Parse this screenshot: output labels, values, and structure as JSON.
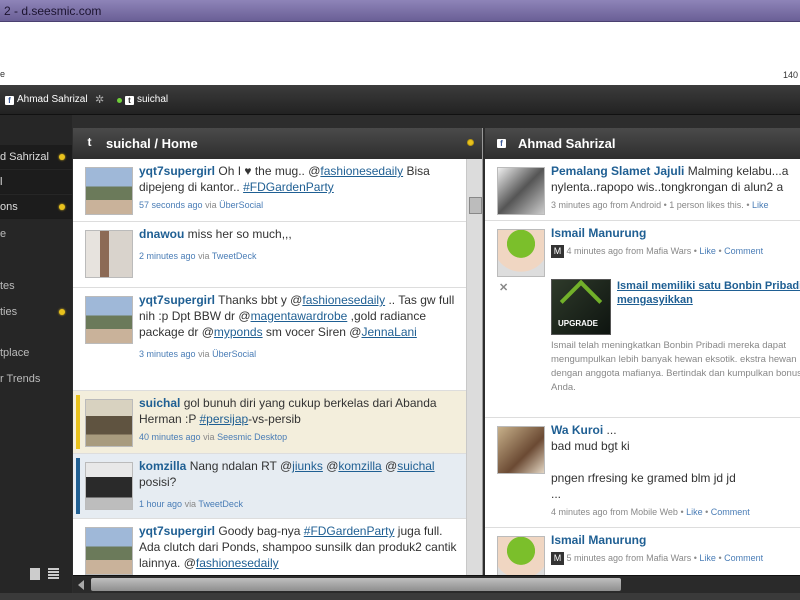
{
  "browser": {
    "title": "2 - d.seesmic.com",
    "left_fragment": "e",
    "right_fragment": "140"
  },
  "topbar": {
    "accounts": [
      {
        "label": "Ahmad Sahrizal"
      },
      {
        "label": "suichal"
      }
    ]
  },
  "sidebar": {
    "items": [
      {
        "label": "d Sahrizal",
        "dot": true
      },
      {
        "label": "l",
        "dot": false
      },
      {
        "label": "ons",
        "dot": true
      },
      {
        "label": "e",
        "dot": false
      },
      {
        "label": "tes",
        "dot": false
      },
      {
        "label": "ties",
        "dot": true
      },
      {
        "label": "tplace",
        "dot": false
      },
      {
        "label": "r Trends",
        "dot": false
      }
    ]
  },
  "col1": {
    "title": "suichal / Home",
    "tweets": [
      {
        "user": "yqt7supergirl",
        "t1": " Oh I ♥ the mug.. @",
        "m1": "fashionesedaily",
        "t2": " Bisa dipejeng di kantor.. ",
        "m2": "#FDGardenParty",
        "time": "57 seconds ago",
        "via": "via",
        "app": "ÜberSocial"
      },
      {
        "user": "dnawou",
        "t1": " miss her so much,,,",
        "time": "2 minutes ago",
        "via": "via",
        "app": "TweetDeck"
      },
      {
        "user": "yqt7supergirl",
        "t1": " Thanks bbt y @",
        "m1": "fashionesedaily",
        "t2": " .. Tas gw full nih :p Dpt BBW dr @",
        "m2": "magentawardrobe",
        "t3": " ,gold radiance package dr @",
        "m3": "myponds",
        "t4": " sm vocer Siren @",
        "m4": "JennaLani",
        "time": "3 minutes ago",
        "via": "via",
        "app": "ÜberSocial"
      },
      {
        "user": "suichal",
        "t1": " gol bunuh diri yang cukup berkelas dari Abanda Herman :P ",
        "m1": "#persijap",
        "t2": "-vs-persib",
        "time": "40 minutes ago",
        "via": "via",
        "app": "Seesmic Desktop"
      },
      {
        "user": "komzilla",
        "t1": " Nang ndalan RT @",
        "m1": "jiunks",
        "t2": " @",
        "m2": "komzilla",
        "t3": " @",
        "m3": "suichal",
        "t4": " posisi?",
        "time": "1 hour ago",
        "via": "via",
        "app": "TweetDeck"
      },
      {
        "user": "yqt7supergirl",
        "t1": " Goody bag-nya ",
        "m1": "#FDGardenParty",
        "t2": " juga full. Ada clutch dari Ponds, shampoo sunsilk dan produk2 cantik lainnya. @",
        "m2": "fashionesedaily"
      }
    ]
  },
  "col2": {
    "title": "Ahmad Sahrizal",
    "posts": [
      {
        "user": "Pemalang Slamet Jajuli",
        "text": " Malming kelabu...a nylenta..rapopo wis..tongkrongan di alun2 a",
        "time": "3 minutes ago",
        "from": "from",
        "src": "Android",
        "extra": "1 person likes this.",
        "like": "Like"
      },
      {
        "user": "Ismail Manurung",
        "time": "4 minutes ago",
        "from": "from",
        "src": "Mafia Wars",
        "like": "Like",
        "comment": "Comment",
        "attach_title": "Ismail memiliki satu Bonbin Pribadi mengasyikkan",
        "attach_img": "UPGRADE",
        "attach_desc": "Ismail   telah meningkatkan Bonbin Pribadi mereka dapat mengumpulkan lebih banyak hewan eksotik. ekstra hewan dengan anggota mafianya. Bertindak dan kumpulkan bonus Anda."
      },
      {
        "user": "Wa Kuroi",
        "text": " ...",
        "line2": "bad mud bgt ki",
        "line3": "pngen rfresing ke gramed blm jd jd",
        "line4": "...",
        "time": "4 minutes ago",
        "from": "from",
        "src": "Mobile Web",
        "like": "Like",
        "comment": "Comment"
      },
      {
        "user": "Ismail Manurung",
        "time": "5 minutes ago",
        "from": "from",
        "src": "Mafia Wars",
        "like": "Like",
        "comment": "Comment"
      }
    ]
  },
  "colors": {
    "accent": "#1f5f93",
    "dot": "#e9c21d",
    "online": "#6fcf3a"
  }
}
